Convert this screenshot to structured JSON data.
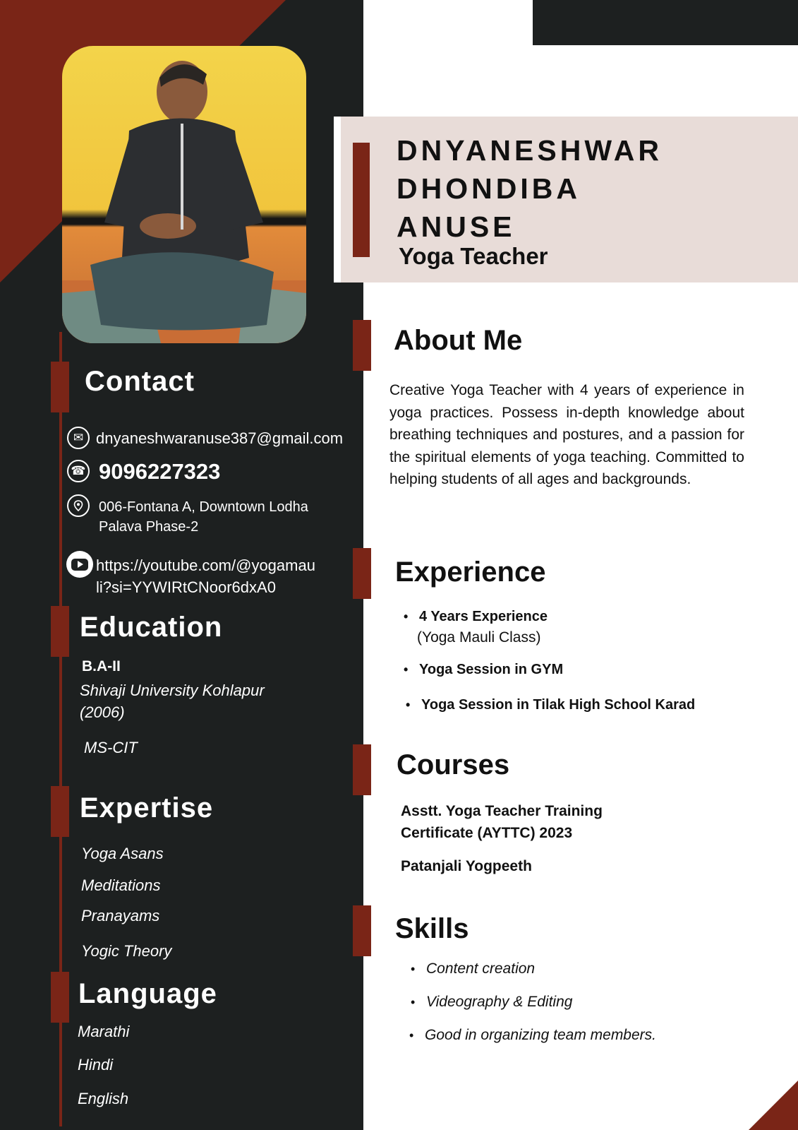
{
  "header": {
    "name_lines": [
      "DNYANESHWAR",
      "DHONDIBA",
      "ANUSE"
    ],
    "job_title": "Yoga Teacher"
  },
  "contact": {
    "heading": "Contact",
    "email": "dnyaneshwaranuse387@gmail.com",
    "phone": "9096227323",
    "address_lines": [
      "006-Fontana A, Downtown Lodha",
      "Palava Phase-2"
    ],
    "youtube_lines": [
      "https://youtube.com/@yogamau",
      "li?si=YYWIRtCNoor6dxA0"
    ],
    "icons": [
      "email-icon",
      "phone-icon",
      "location-icon",
      "youtube-icon"
    ]
  },
  "education": {
    "heading": "Education",
    "degree": "B.A-II",
    "institution": "Shivaji University Kohlapur",
    "year": "(2006)",
    "course": "MS-CIT"
  },
  "expertise": {
    "heading": "Expertise",
    "items": [
      "Yoga Asans",
      "Meditations",
      "Pranayams",
      "Yogic Theory"
    ]
  },
  "language": {
    "heading": "Language",
    "items": [
      "Marathi",
      "Hindi",
      "English"
    ]
  },
  "about": {
    "heading": "About Me",
    "text": "Creative Yoga Teacher with 4 years of experience in yoga practices. Possess in-depth knowledge about breathing techniques and postures, and a passion for the spiritual elements of yoga teaching. Committed to helping students of all ages and backgrounds."
  },
  "experience": {
    "heading": "Experience",
    "items": [
      {
        "title": "4 Years Experience",
        "sub": "(Yoga Mauli Class)"
      },
      {
        "title": "Yoga Session in GYM"
      },
      {
        "title": "Yoga Session in Tilak High School Karad"
      }
    ]
  },
  "courses": {
    "heading": "Courses",
    "lines": [
      "Asstt. Yoga Teacher Training",
      "Certificate (AYTTC) 2023"
    ],
    "institute": "Patanjali Yogpeeth"
  },
  "skills": {
    "heading": "Skills",
    "items": [
      "Content creation",
      "Videography & Editing",
      "Good in organizing team members."
    ]
  },
  "colors": {
    "accent": "#7a2517",
    "sidebar": "#1d2020",
    "name_band": "#e8dcd8"
  }
}
